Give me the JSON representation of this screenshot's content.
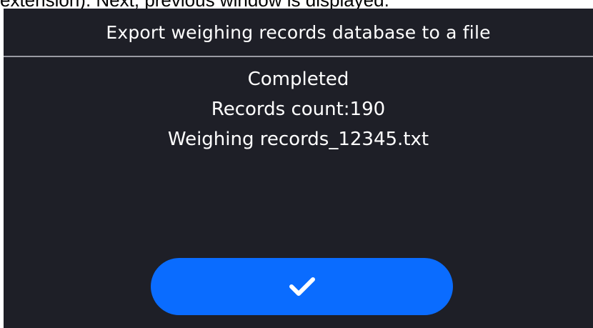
{
  "caption": "extension). Next, previous window is displayed.",
  "dialog": {
    "title": "Export weighing records database to a file",
    "status": "Completed",
    "records_count": "Records count:190",
    "filename": "Weighing records_12345.txt",
    "confirm_icon": "checkmark-icon"
  },
  "colors": {
    "background": "#1e1f27",
    "button": "#0a6cff",
    "divider": "#9a9ba3",
    "text": "#ffffff"
  }
}
